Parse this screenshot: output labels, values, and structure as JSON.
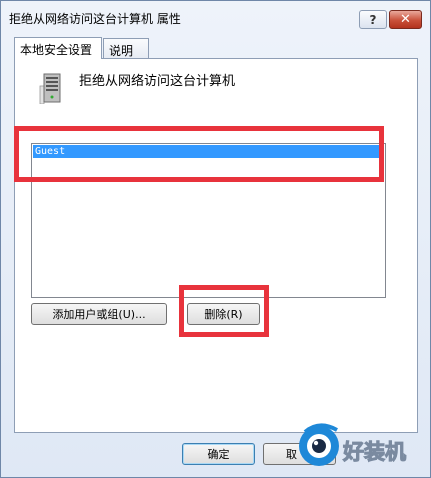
{
  "window": {
    "title": "拒绝从网络访问这台计算机 属性"
  },
  "titlebar": {
    "help_label": "?",
    "close_label": "✕"
  },
  "tabs": [
    {
      "label": "本地安全设置",
      "active": true
    },
    {
      "label": "说明",
      "active": false
    }
  ],
  "policy": {
    "title": "拒绝从网络访问这台计算机",
    "icon": "server-icon"
  },
  "accounts": {
    "items": [
      "Guest"
    ],
    "selected": "Guest"
  },
  "buttons": {
    "add_label": "添加用户或组(U)...",
    "remove_label": "删除(R)",
    "ok_label": "确定",
    "cancel_label": "取"
  },
  "watermark": {
    "text": "好装机",
    "icon": "watermark-logo-icon"
  },
  "colors": {
    "highlight": "#e8333c",
    "selection": "#3399ff"
  }
}
